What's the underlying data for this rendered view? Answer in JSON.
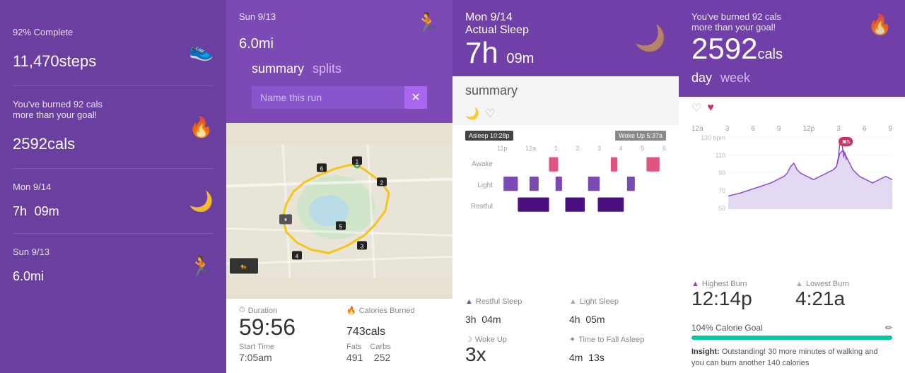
{
  "panel1": {
    "steps_label": "92% Complete",
    "steps_value": "11,470",
    "steps_unit": "steps",
    "cals_label": "You've burned 92 cals\nmore than your goal!",
    "cals_value": "2592",
    "cals_unit": "cals",
    "sleep_date": "Mon 9/14",
    "sleep_value": "7h",
    "sleep_min": "09m",
    "run_date": "Sun 9/13",
    "run_value": "6.0",
    "run_unit": "mi"
  },
  "panel2": {
    "date_label": "Sun 9/13",
    "distance": "6.0",
    "distance_unit": "mi",
    "tab_summary": "summary",
    "tab_splits": "splits",
    "search_placeholder": "Name this run",
    "duration_label": "Duration",
    "duration_value": "59:56",
    "calories_label": "Calories Burned",
    "calories_value": "743",
    "calories_unit": "cals",
    "start_label": "Start Time",
    "start_value": "7:05am",
    "fats_label": "Fats",
    "fats_value": "491",
    "carbs_label": "Carbs",
    "carbs_value": "252"
  },
  "panel3": {
    "date_label": "Mon 9/14",
    "sleep_type": "Actual Sleep",
    "sleep_value": "7h",
    "sleep_min": "09m",
    "tab_summary": "summary",
    "asleep_badge": "Asleep 10:28p",
    "woke_badge": "Woke Up 5:37a",
    "chart_x_labels": [
      "11p",
      "12a",
      "1",
      "2",
      "3",
      "4",
      "5",
      "6"
    ],
    "chart_y_labels": [
      "Awake",
      "Light",
      "Restful"
    ],
    "restful_label": "Restful Sleep",
    "restful_value": "3h",
    "restful_min": "04m",
    "light_label": "Light Sleep",
    "light_value": "4h",
    "light_min": "05m",
    "woke_label": "Woke Up",
    "woke_value": "3x",
    "fall_label": "Time to Fall Asleep",
    "fall_value": "4m",
    "fall_sec": "13s"
  },
  "panel4": {
    "header_text": "You've burned 92 cals\nmore than your goal!",
    "cals_value": "2592",
    "cals_unit": "cals",
    "tab_day": "day",
    "tab_week": "week",
    "chart_x_labels": [
      "12a",
      "3",
      "6",
      "9",
      "12p",
      "3",
      "6",
      "9"
    ],
    "chart_y_labels": [
      "130 bpm",
      "110",
      "90",
      "70",
      "50"
    ],
    "heart_rate": "115",
    "highest_label": "Highest Burn",
    "highest_value": "12:14p",
    "lowest_label": "Lowest Burn",
    "lowest_value": "4:21a",
    "goal_label": "104% Calorie Goal",
    "goal_percent": 104,
    "insight_text": "Insight: Outstanding! 30 more minutes of walking and you can burn another 140 calories"
  }
}
